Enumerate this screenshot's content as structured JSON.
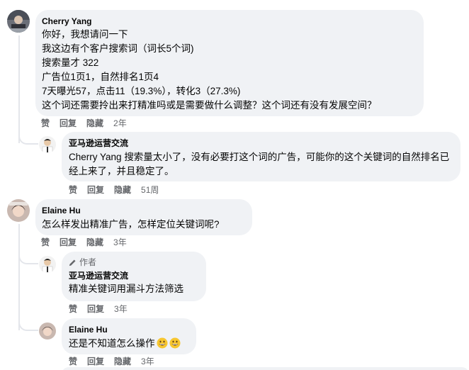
{
  "comments": [
    {
      "author": "Cherry Yang",
      "lines": [
        "你好，我想请问一下",
        "我这边有个客户搜索词（词长5个词)",
        "搜索量才 322",
        "广告位1页1，自然排名1页4",
        "7天曝光57，点击11（19.3%），转化3（27.3%)",
        "这个词还需要拎出来打精准吗或是需要做什么调整？这个词还有没有发展空间？"
      ],
      "like": "赞",
      "reply": "回复",
      "hide": "隐藏",
      "time": "2年"
    },
    {
      "author": "亚马逊运营交流",
      "mention": "Cherry Yang",
      "text": "搜索量太小了，没有必要打这个词的广告，可能你的这个关键词的自然排名已经上来了，并且稳定了。",
      "like": "赞",
      "reply": "回复",
      "hide": "隐藏",
      "time": "51周"
    },
    {
      "author": "Elaine Hu",
      "lines": [
        "怎么样发出精准广告，怎样定位关键词呢?"
      ],
      "like": "赞",
      "reply": "回复",
      "hide": "隐藏",
      "time": "3年"
    },
    {
      "badge": "作者",
      "author": "亚马逊运营交流",
      "lines": [
        "精准关键词用漏斗方法筛选"
      ],
      "like": "赞",
      "reply": "回复",
      "hide": "隐藏",
      "time": "3年"
    },
    {
      "author": "Elaine Hu",
      "text": "还是不知道怎么操作",
      "emoji": [
        "grinning-emoji",
        "grinning-emoji"
      ],
      "like": "赞",
      "reply": "回复",
      "hide": "隐藏",
      "time": "3年"
    }
  ],
  "colors": {
    "bubble": "#f0f2f5",
    "text": "#050505",
    "secondary": "#65676b",
    "thread": "#e4e6eb"
  }
}
